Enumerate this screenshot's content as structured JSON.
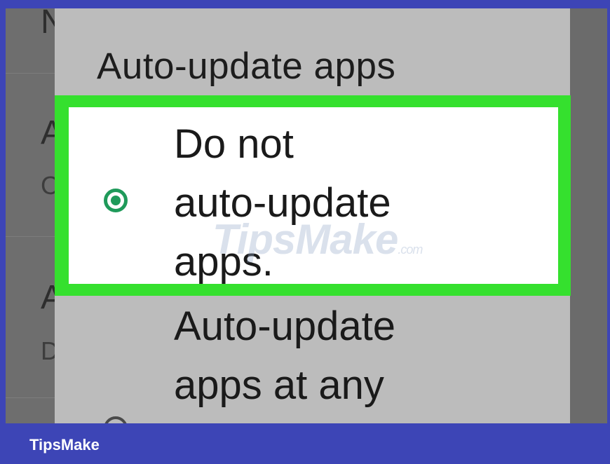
{
  "dialog": {
    "title": "Auto-update apps",
    "options": [
      {
        "label": "Do not\nauto-update\napps.",
        "selected": true
      },
      {
        "label": "Auto-update\napps at any\ntime. Data",
        "selected": false
      }
    ]
  },
  "background_list": {
    "letters": [
      "N",
      "A",
      "C",
      "A",
      "D"
    ]
  },
  "watermark": {
    "text": "TipsMake",
    "suffix": ".com"
  },
  "footer": {
    "brand": "TipsMake"
  },
  "colors": {
    "frame": "#3d45b6",
    "highlight": "#35e02e",
    "radio_selected": "#1f9a5a",
    "dialog_bg": "#bcbcbc"
  }
}
